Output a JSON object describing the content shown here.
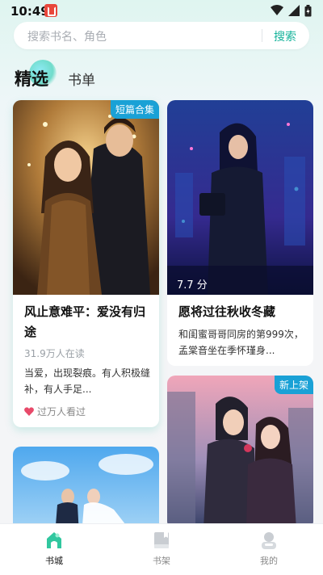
{
  "status_bar": {
    "time": "10:49"
  },
  "search": {
    "placeholder": "搜索书名、角色",
    "button": "搜索"
  },
  "tabs": [
    {
      "label": "精选"
    },
    {
      "label": "书单"
    }
  ],
  "books": [
    {
      "title": "风止意难平：爱没有归途",
      "readers": "31.9万人在读",
      "intro": "当爱，出现裂痕。有人积极缝补，有人手足...",
      "tag": "短篇合集",
      "hot": "过万人看过"
    },
    {
      "title": "愿将过往秋收冬藏",
      "score": "7.7 分",
      "intro": "和闺蜜哥哥同房的第999次，孟棠音坐在季怀瑾身..."
    },
    {
      "tag": "新上架"
    },
    {}
  ],
  "bottom_nav": [
    {
      "label": "书城",
      "icon": "bookstore-icon"
    },
    {
      "label": "书架",
      "icon": "bookshelf-icon"
    },
    {
      "label": "我的",
      "icon": "profile-icon"
    }
  ],
  "colors": {
    "accent": "#14b39a",
    "tag": "#1aa1d6",
    "hot": "#e84a6a"
  }
}
